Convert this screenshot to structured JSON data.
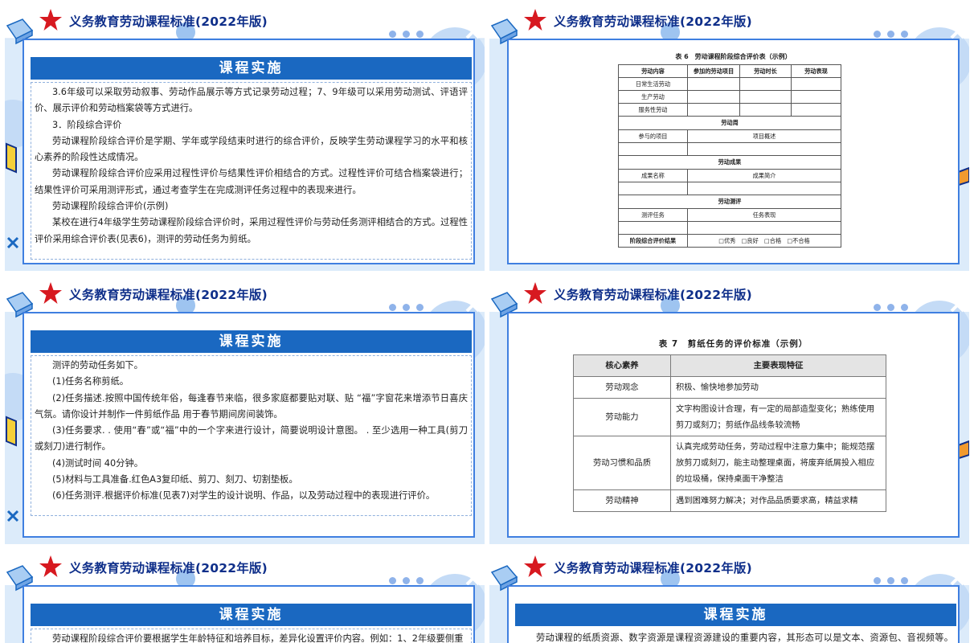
{
  "header_title": "义务教育劳动课程标准(2022年版)",
  "banner": "课程实施",
  "colors": {
    "navy": "#0f2f8a",
    "banner_blue": "#1a68c1",
    "star_red": "#d71920",
    "frame_blue": "#3f7fe0",
    "bg_blue": "#dcebfa"
  },
  "icons": [
    "star-icon",
    "cube-icon",
    "cross-icon",
    "dot-icon"
  ],
  "slide1": {
    "paragraphs": [
      "3.6年级可以采取劳动叙事、劳动作品展示等方式记录劳动过程；7、9年级可以采用劳动测试、评语评价、展示评价和劳动档案袋等方式进行。",
      "3．阶段综合评价",
      "劳动课程阶段综合评价是学期、学年或学段结束时进行的综合评价，反映学生劳动课程学习的水平和核心素养的阶段性达成情况。",
      "劳动课程阶段综合评价应采用过程性评价与结果性评价相结合的方式。过程性评价可结合档案袋进行；结果性评价可采用测评形式，通过考查学生在完成测评任务过程中的表现来进行。",
      "劳动课程阶段综合评价(示例)",
      "某校在进行4年级学生劳动课程阶段综合评价时，采用过程性评价与劳动任务测评相结合的方式。过程性评价采用综合评价表(见表6)，测评的劳动任务为剪纸。"
    ]
  },
  "slide2": {
    "caption": "表 6　劳动课程阶段综合评价表（示例）",
    "headers": [
      "劳动内容",
      "参加的劳动项目",
      "劳动时长",
      "劳动表现"
    ],
    "rows": [
      "日常生活劳动",
      "生产劳动",
      "服务性劳动"
    ],
    "sections": [
      {
        "title": "劳动周",
        "left": "参与的项目",
        "right": "项目概述"
      },
      {
        "title": "劳动成果",
        "left": "成果名称",
        "right": "成果简介"
      },
      {
        "title": "劳动测评",
        "left": "测评任务",
        "right": "任务表现"
      }
    ],
    "result_label": "阶段综合评价结果",
    "result_options": "□优秀　□良好　□合格　□不合格"
  },
  "slide3": {
    "paragraphs": [
      "测评的劳动任务如下。",
      "(1)任务名称剪纸。",
      "(2)任务描述.按照中国传统年俗，每逢春节来临，很多家庭都要贴对联、贴 “福”字窗花来增添节日喜庆气氛。请你设计并制作一件剪纸作品 用于春节期间房间装饰。",
      "(3)任务要求. . 使用“春”或“福”中的一个字来进行设计，简要说明设计意图。 . 至少选用一种工具(剪刀或刻刀)进行制作。",
      "(4)测试时间 40分钟。",
      "(5)材料与工具准备.红色A3复印纸、剪刀、刻刀、切割垫板。",
      "(6)任务测评.根据评价标准(见表7)对学生的设计说明、作品，以及劳动过程中的表现进行评价。"
    ]
  },
  "slide4": {
    "caption": "表 7　剪纸任务的评价标准（示例）",
    "headers": [
      "核心素养",
      "主要表现特征"
    ],
    "rows": [
      {
        "k": "劳动观念",
        "v": "积极、愉快地参加劳动"
      },
      {
        "k": "劳动能力",
        "v": "文字构图设计合理，有一定的局部造型变化；熟练使用剪刀或刻刀；剪纸作品线条较流畅"
      },
      {
        "k": "劳动习惯和品质",
        "v": "认真完成劳动任务，劳动过程中注意力集中；能规范摆放剪刀或刻刀，能主动整理桌面，将废弃纸屑投入相应的垃圾桶，保持桌面干净整洁"
      },
      {
        "k": "劳动精神",
        "v": "遇到困难努力解决；对作品品质要求高，精益求精"
      }
    ]
  },
  "slide5": {
    "paragraphs": [
      "劳动课程阶段综合评价要根据学生年龄特征和培养目标，差异化设置评价内容。例如：1、2年级要侧重"
    ]
  },
  "slide6": {
    "paragraphs": [
      "劳动课程的纸质资源、数字资源是课程资源建设的重要内容，其形态可以是文本、资源包、音视频等。不"
    ]
  }
}
